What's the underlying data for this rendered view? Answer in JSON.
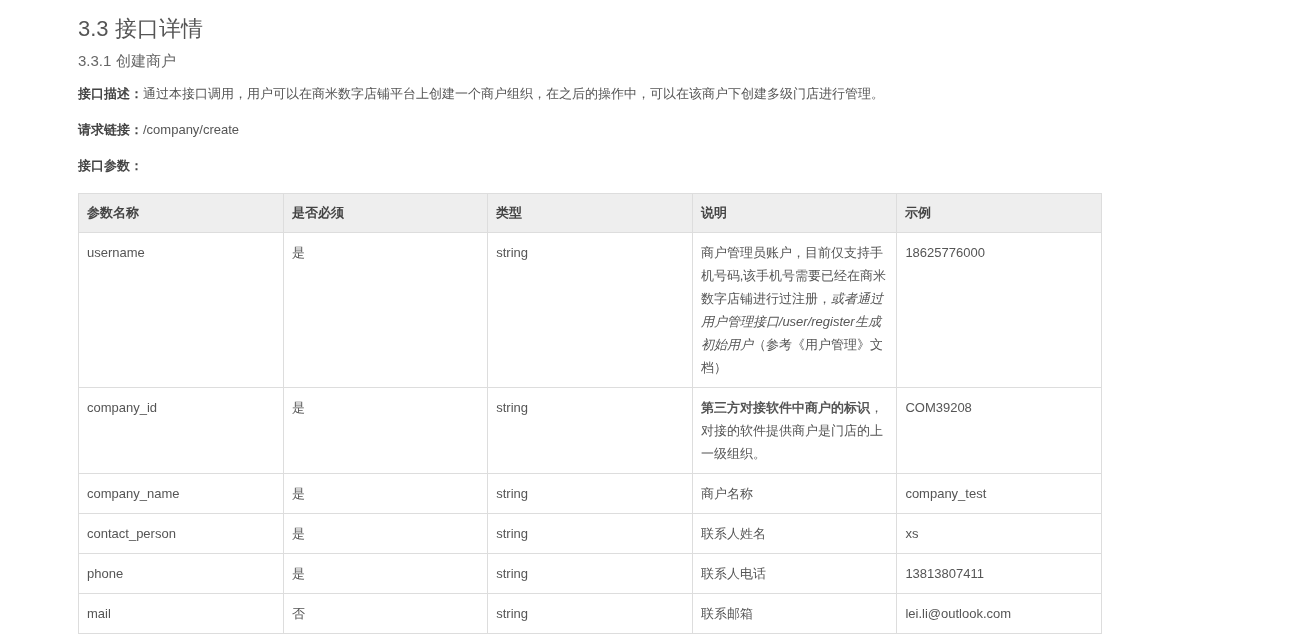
{
  "title": "3.3 接口详情",
  "subtitle": "3.3.1 创建商户",
  "paragraphs": [
    "**接口描述：**通过本接口调用，用户可以在商米数字店铺平台上创建一个商户组织，在之后的操作中，可以在该商户下创建多级门店进行管理。",
    "**请求链接：**/company/create",
    "**接口参数：**"
  ],
  "table": {
    "columns": [
      "参数名称",
      "是否必须",
      "类型",
      "说明",
      "示例"
    ],
    "rows": [
      [
        "username",
        "是",
        "string",
        "商户管理员账户，目前仅支持手机号码,该手机号需要已经在商米数字店铺进行过注册，*或者通过用户管理接口/user/register生成初始用户*（参考《用户管理》文档）",
        "18625776000"
      ],
      [
        "company_id",
        "是",
        "string",
        "**第三方对接软件中商户的标识**，对接的软件提供商户是门店的上一级组织。",
        "COM39208"
      ],
      [
        "company_name",
        "是",
        "string",
        "商户名称",
        "company_test"
      ],
      [
        "contact_person",
        "是",
        "string",
        "联系人姓名",
        "xs"
      ],
      [
        "phone",
        "是",
        "string",
        "联系人电话",
        "13813807411"
      ],
      [
        "mail",
        "否",
        "string",
        "联系邮箱",
        "lei.li@outlook.com"
      ]
    ]
  }
}
